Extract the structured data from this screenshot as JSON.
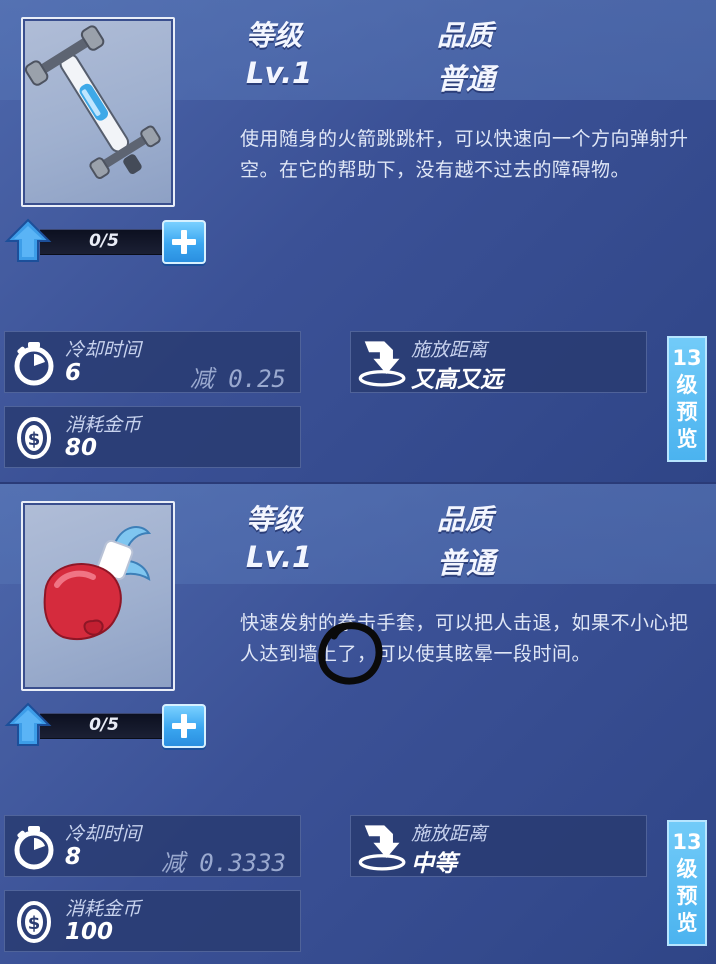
{
  "colors": {
    "panel_bg": "#3b5196",
    "header_text": "#f3f6ff",
    "accent_blue": "#4bb3ef",
    "stat_bg": "#283a70"
  },
  "skills": [
    {
      "level_label": "等级",
      "level_value": "Lv.1",
      "quality_label": "品质",
      "quality_value": "普通",
      "description": "使用随身的火箭跳跳杆，可以快速向一个方向弹射升空。在它的帮助下，没有越不过去的障碍物。",
      "progress": "0/5",
      "cooldown": {
        "label": "冷却时间",
        "value": "6",
        "reduction": "减 0.25"
      },
      "range": {
        "label": "施放距离",
        "value": "又高又远"
      },
      "cost": {
        "label": "消耗金币",
        "value": "80"
      },
      "preview_button": [
        "13",
        "级",
        "预",
        "览"
      ],
      "icon": "rocket-pogo-stick-icon"
    },
    {
      "level_label": "等级",
      "level_value": "Lv.1",
      "quality_label": "品质",
      "quality_value": "普通",
      "description": "快速发射的拳击手套，可以把人击退，如果不小心把人达到墙上了，可以使其眩晕一段时间。",
      "progress": "0/5",
      "cooldown": {
        "label": "冷却时间",
        "value": "8",
        "reduction": "减 0.3333"
      },
      "range": {
        "label": "施放距离",
        "value": "中等"
      },
      "cost": {
        "label": "消耗金币",
        "value": "100"
      },
      "preview_button": [
        "13",
        "级",
        "预",
        "览"
      ],
      "icon": "boxing-glove-icon"
    }
  ]
}
